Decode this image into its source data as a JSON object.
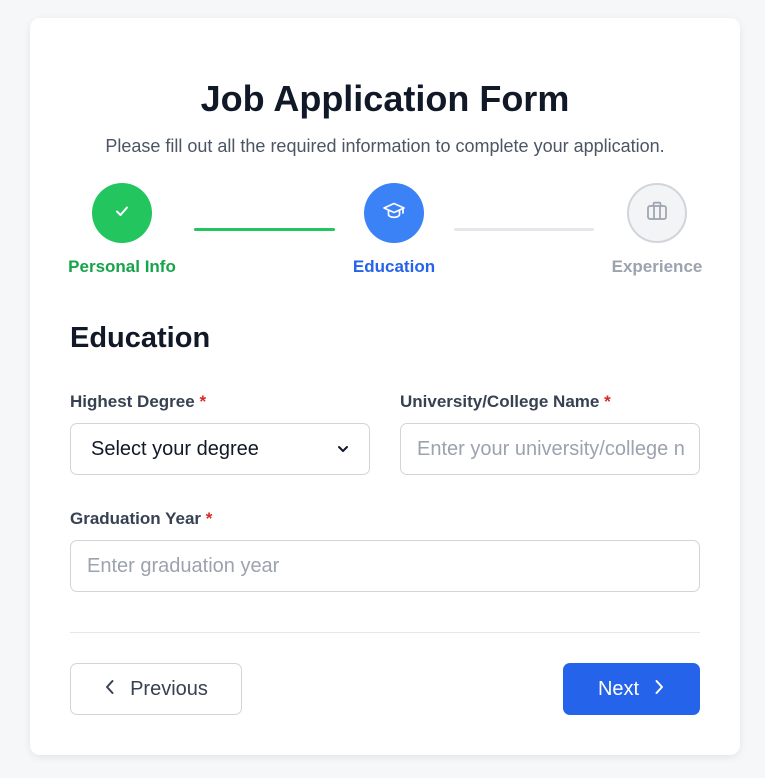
{
  "header": {
    "title": "Job Application Form",
    "subtitle": "Please fill out all the required information to complete your application."
  },
  "steps": [
    {
      "label": "Personal Info",
      "state": "complete",
      "icon": "check-icon",
      "color": "#22c55e"
    },
    {
      "label": "Education",
      "state": "active",
      "icon": "graduation-cap-icon",
      "color": "#3b82f6"
    },
    {
      "label": "Experience",
      "state": "upcoming",
      "icon": "briefcase-icon",
      "color": "#9ca3af"
    }
  ],
  "section": {
    "title": "Education"
  },
  "fields": {
    "degree": {
      "label": "Highest Degree",
      "required_mark": "*",
      "selected": "Select your degree"
    },
    "university": {
      "label": "University/College Name",
      "required_mark": "*",
      "placeholder": "Enter your university/college name",
      "visible_placeholder": "Enter your university/college n"
    },
    "graduation_year": {
      "label": "Graduation Year",
      "required_mark": "*",
      "placeholder": "Enter graduation year"
    }
  },
  "actions": {
    "previous_label": "Previous",
    "next_label": "Next"
  },
  "colors": {
    "primary": "#2563eb",
    "success": "#22c55e",
    "required": "#dc2626"
  }
}
